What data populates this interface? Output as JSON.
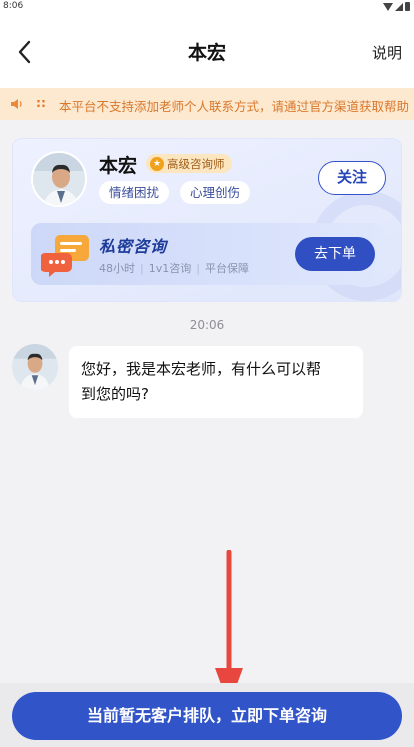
{
  "status_bar": {
    "time": "8:06"
  },
  "header": {
    "title": "本宏",
    "right_action": "说明"
  },
  "notice": {
    "colon": "::",
    "text": "本平台不支持添加老师个人联系方式，请通过官方渠道获取帮助"
  },
  "teacher_card": {
    "name": "本宏",
    "badge": "高级咨询师",
    "tags": [
      "情绪困扰",
      "心理创伤"
    ],
    "follow_label": "关注",
    "service": {
      "title": "私密咨询",
      "duration": "48小时",
      "mode": "1v1咨询",
      "guarantee": "平台保障",
      "order_label": "去下单"
    }
  },
  "chat": {
    "timestamp": "20:06",
    "messages": [
      {
        "sender": "teacher",
        "text_line1": "您好，我是本宏老师，有什么可以帮",
        "text_line2": "到您的吗?"
      }
    ]
  },
  "cta": {
    "label": "当前暂无客户排队，立即下单咨询"
  },
  "colors": {
    "primary": "#3155c8",
    "notice_bg": "#fde9cf",
    "notice_text": "#d9772b",
    "arrow": "#e8473f"
  }
}
